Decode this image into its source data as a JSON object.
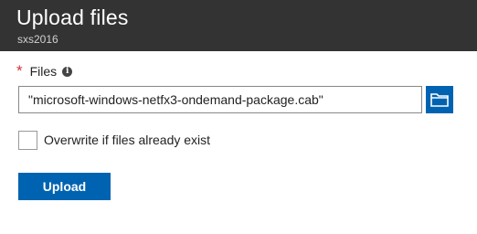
{
  "header": {
    "title": "Upload files",
    "subtitle": "sxs2016",
    "background": "#333333"
  },
  "form": {
    "files_field": {
      "required_marker": "*",
      "label": "Files",
      "info_icon": "info-icon",
      "value": "\"microsoft-windows-netfx3-ondemand-package.cab\"",
      "browse_icon": "folder-icon"
    },
    "overwrite_checkbox": {
      "label": "Overwrite if files already exist",
      "checked": false
    },
    "upload_button": {
      "label": "Upload"
    }
  },
  "colors": {
    "accent": "#0063b1",
    "required": "#d13438"
  }
}
